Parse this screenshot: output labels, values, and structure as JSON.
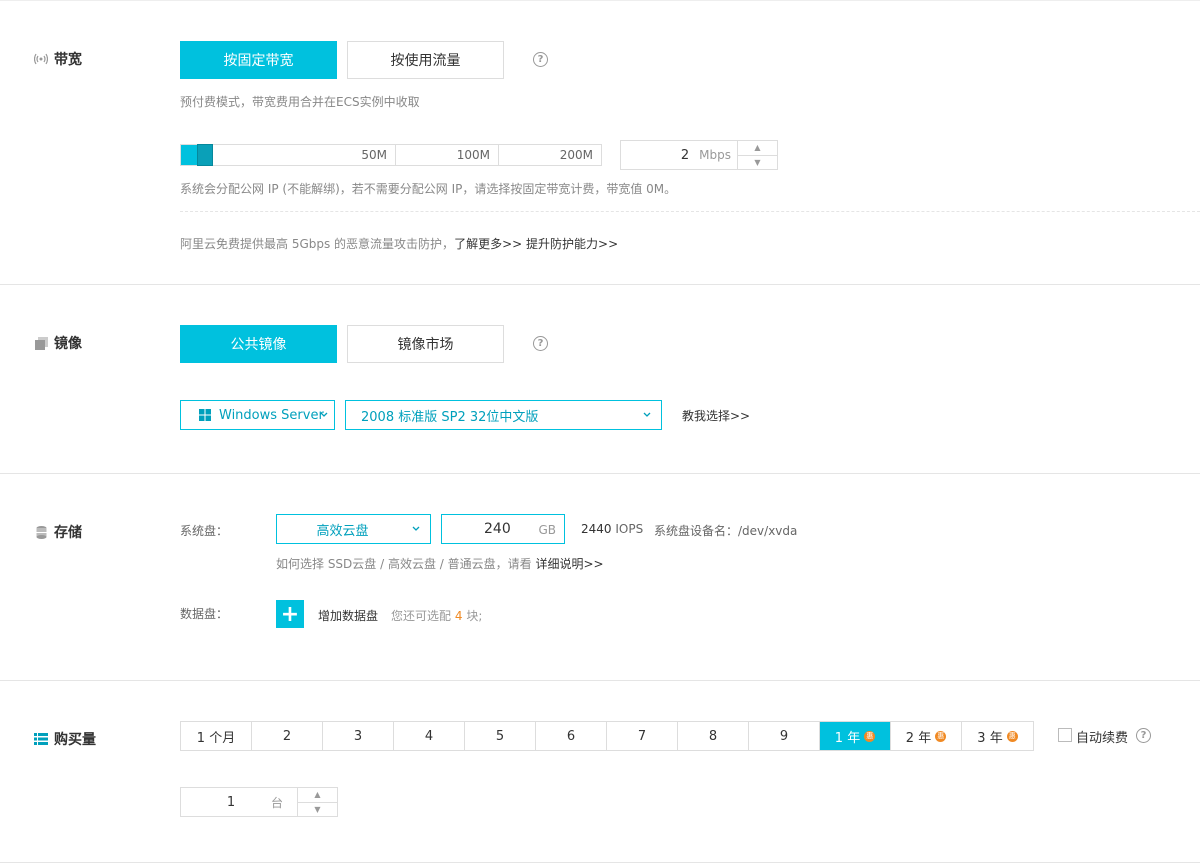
{
  "bandwidth": {
    "title": "带宽",
    "tab_fixed": "按固定带宽",
    "tab_traffic": "按使用流量",
    "help": "?",
    "billing_note": "预付费模式，带宽费用合并在ECS实例中收取",
    "slider_ticks": [
      "50M",
      "100M",
      "200M"
    ],
    "value": "2",
    "unit": "Mbps",
    "ip_note": "系统会分配公网 IP (不能解绑)，若不需要分配公网 IP，请选择按固定带宽计费，带宽值 0M。",
    "protect_note": "阿里云免费提供最高 5Gbps 的恶意流量攻击防护，",
    "learn_more": "了解更多>>",
    "upgrade": "提升防护能力>>"
  },
  "image": {
    "title": "镜像",
    "tab_public": "公共镜像",
    "tab_market": "镜像市场",
    "help": "?",
    "os_select": "Windows Server",
    "version_select": "2008 标准版 SP2 32位中文版",
    "teach_link": "教我选择>>"
  },
  "storage": {
    "title": "存储",
    "system_disk_label": "系统盘：",
    "disk_type": "高效云盘",
    "disk_size": "240",
    "disk_unit": "GB",
    "iops_value": "2440",
    "iops_label": "IOPS",
    "device_label": "系统盘设备名：/dev/xvda",
    "howto_note": "如何选择 SSD云盘 / 高效云盘 / 普通云盘，请看",
    "detail_link": "详细说明>>",
    "data_disk_label": "数据盘：",
    "add_data_disk": "增加数据盘",
    "remaining_prefix": "您还可选配",
    "remaining_count": "4",
    "remaining_suffix": "块;"
  },
  "purchase": {
    "title": "购买量",
    "options": [
      "1 个月",
      "2",
      "3",
      "4",
      "5",
      "6",
      "7",
      "8",
      "9",
      "1 年",
      "2 年",
      "3 年"
    ],
    "badge": "惠",
    "auto_renew": "自动续费",
    "help": "?",
    "count": "1",
    "count_unit": "台"
  }
}
